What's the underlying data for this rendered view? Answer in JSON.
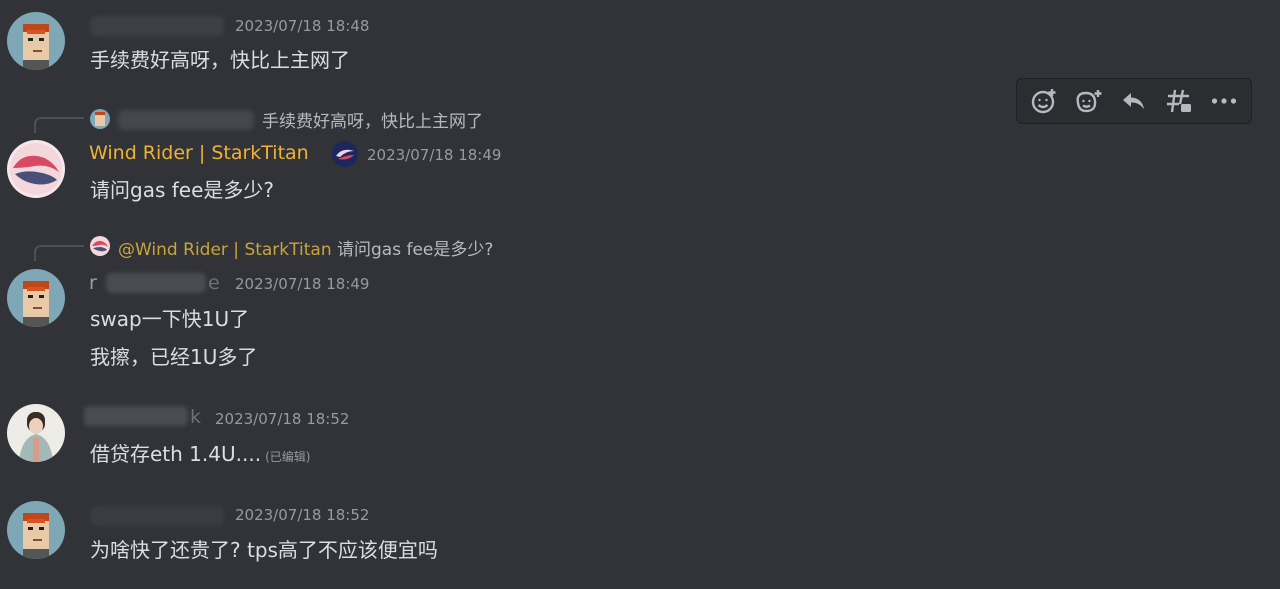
{
  "messages": [
    {
      "timestamp": "2023/07/18 18:48",
      "text": "手续费好高呀，快比上主网了"
    },
    {
      "reply_text": "手续费好高呀，快比上主网了",
      "author": "Wind Rider | StarkTitan",
      "timestamp": "2023/07/18 18:49",
      "text": "请问gas fee是多少?"
    },
    {
      "reply_mention": "@Wind Rider | StarkTitan",
      "reply_text": "请问gas fee是多少?",
      "author_fragment_start": "r",
      "author_fragment_end": "e",
      "timestamp": "2023/07/18 18:49",
      "lines": [
        "swap一下快1U了",
        "我擦，已经1U多了"
      ]
    },
    {
      "author_fragment_end": "k",
      "timestamp": "2023/07/18 18:52",
      "text": "借贷存eth 1.4U....",
      "edited": "(已编辑)"
    },
    {
      "timestamp": "2023/07/18 18:52",
      "text": "为啥快了还贵了? tps高了不应该便宜吗"
    }
  ],
  "toolbar": {
    "icons": [
      "add-reaction-icon",
      "add-super-reaction-icon",
      "reply-icon",
      "create-thread-icon",
      "more-icon"
    ]
  },
  "colors": {
    "background": "#313338",
    "author_gold": "#f0b232",
    "mention_gold": "#c9a53a",
    "timestamp": "#949ba4"
  }
}
